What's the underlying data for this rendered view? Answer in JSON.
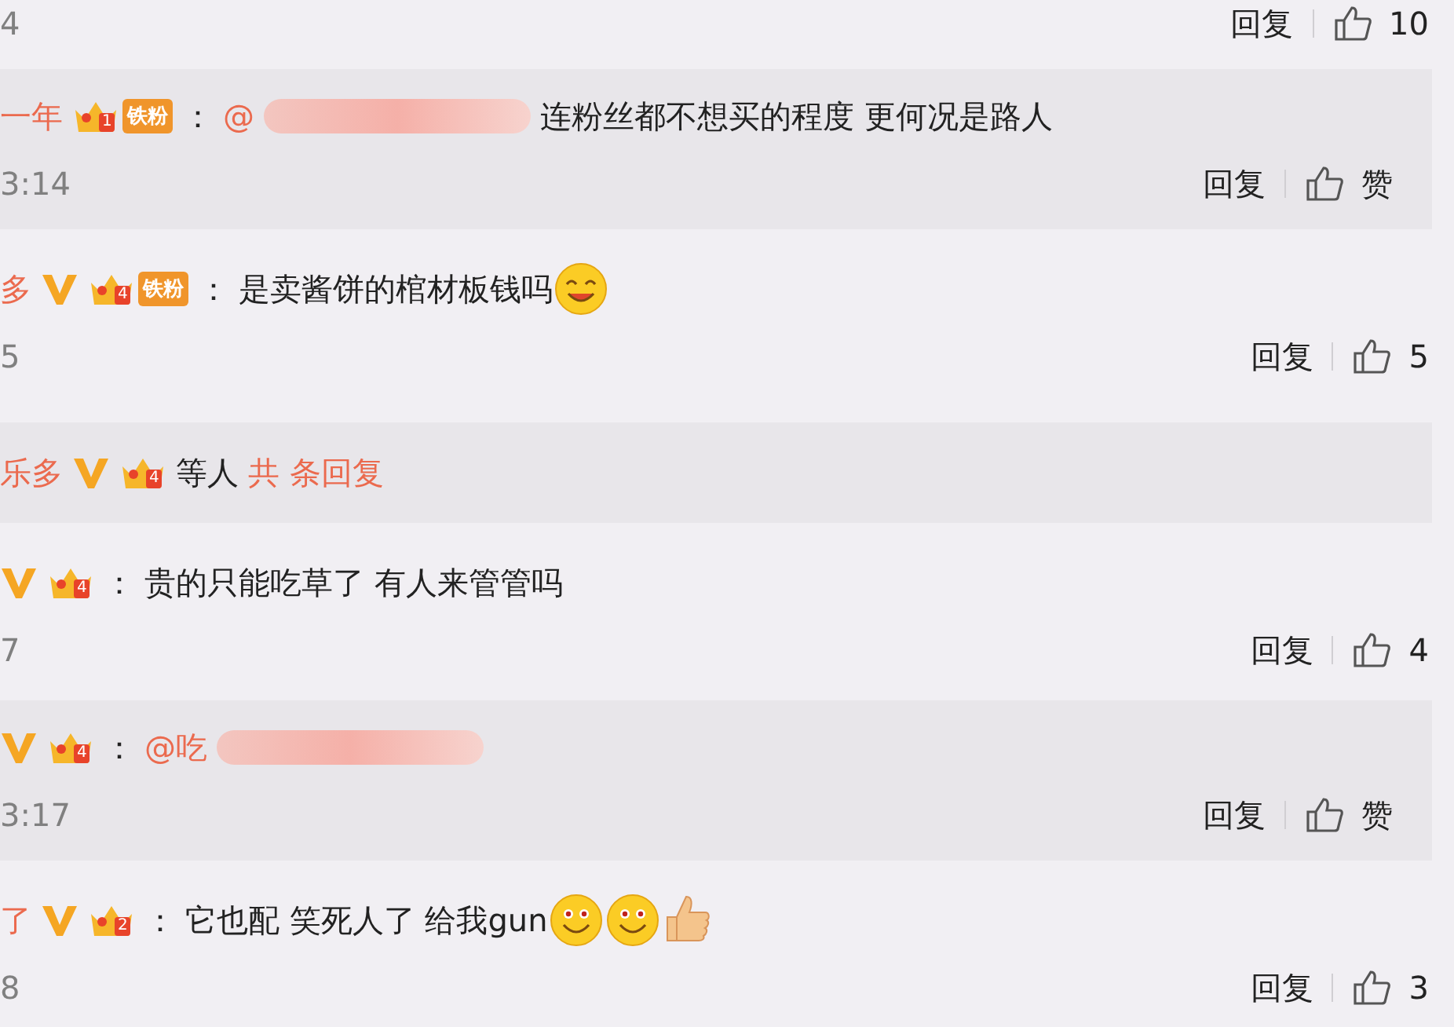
{
  "comments": [
    {
      "kind": "comment",
      "time": "4",
      "reply_label": "回复",
      "like_count": "10"
    },
    {
      "kind": "reply",
      "name": "一年",
      "verified": false,
      "fan_level": "1",
      "fan_label": "铁粉",
      "colon": "：",
      "mention": "@",
      "mention_blurred": true,
      "text": "连粉丝都不想买的程度 更何况是路人",
      "time": "3:14",
      "reply_label": "回复",
      "like_count": "赞"
    },
    {
      "kind": "comment",
      "name": "多",
      "verified": true,
      "fan_level": "4",
      "fan_label": "铁粉",
      "colon": "：",
      "text": "是卖酱饼的棺材板钱吗",
      "emojis": [
        {
          "kind": "smile"
        }
      ],
      "time": "5",
      "reply_label": "回复",
      "like_count": "5"
    },
    {
      "kind": "summary",
      "name": "乐多",
      "verified": true,
      "fan_level": "4",
      "text": "等人",
      "more": "共 条回复"
    },
    {
      "kind": "comment",
      "verified": true,
      "fan_level": "4",
      "colon": "：",
      "text": "贵的只能吃草了 有人来管管吗",
      "time": "7",
      "reply_label": "回复",
      "like_count": "4"
    },
    {
      "kind": "reply",
      "verified": true,
      "fan_level": "4",
      "colon": "：",
      "mention": "@吃",
      "mention_blurred": true,
      "time": "3:17",
      "reply_label": "回复",
      "like_count": "赞"
    },
    {
      "kind": "comment",
      "name": "了",
      "verified": true,
      "fan_level": "2",
      "colon": "：",
      "text": "它也配 笑死人了 给我gun",
      "emojis": [
        {
          "kind": "grin"
        },
        {
          "kind": "grin"
        },
        {
          "kind": "thumb"
        }
      ],
      "time": "8",
      "reply_label": "回复",
      "like_count": "3"
    }
  ]
}
